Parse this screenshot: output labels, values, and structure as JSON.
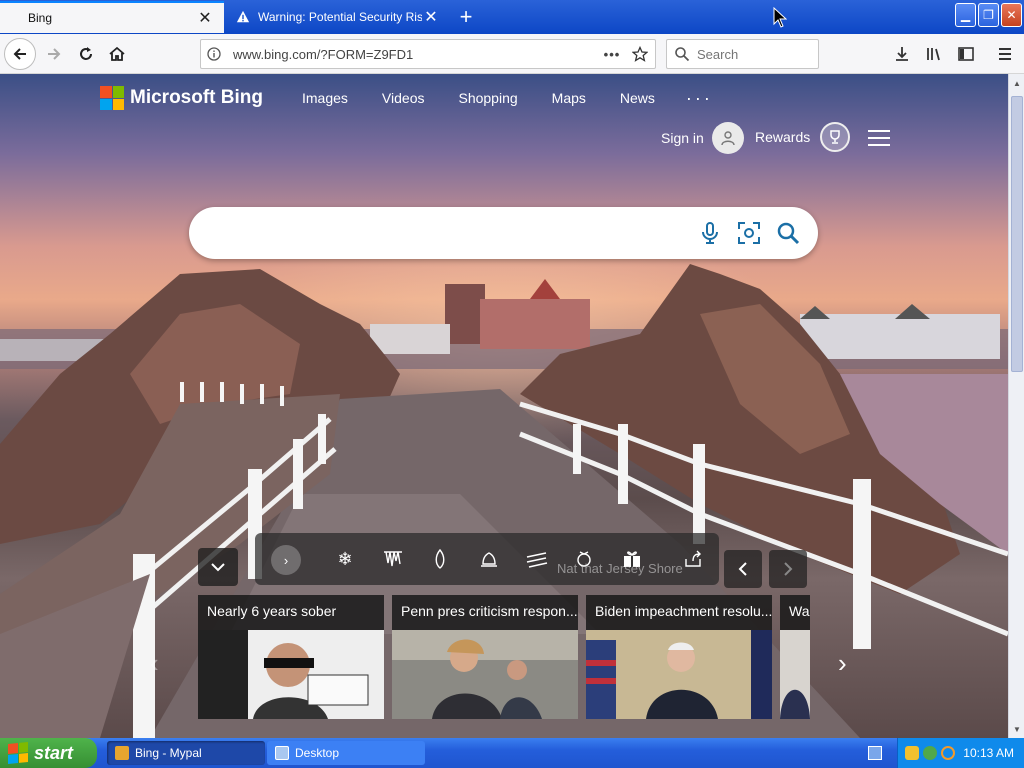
{
  "browser": {
    "tabs": [
      {
        "title": "Bing",
        "active": true
      },
      {
        "title": "Warning: Potential Security Risk A",
        "active": false
      }
    ],
    "url": "www.bing.com/?FORM=Z9FD1",
    "search_placeholder": "Search"
  },
  "bing": {
    "brand": "Microsoft Bing",
    "nav": [
      "Images",
      "Videos",
      "Shopping",
      "Maps",
      "News"
    ],
    "more": "···",
    "sign_in": "Sign in",
    "rewards": "Rewards",
    "location_text": "Nat that Jersey Shore",
    "news": [
      {
        "title": "Nearly 6 years sober"
      },
      {
        "title": "Penn pres criticism respon..."
      },
      {
        "title": "Biden impeachment resolu..."
      },
      {
        "title": "War"
      }
    ],
    "logo_colors": [
      "#f25022",
      "#7fba00",
      "#00a4ef",
      "#ffb900"
    ]
  },
  "taskbar": {
    "start": "start",
    "items": [
      "Bing - Mypal",
      "Desktop"
    ],
    "time": "10:13 AM"
  }
}
